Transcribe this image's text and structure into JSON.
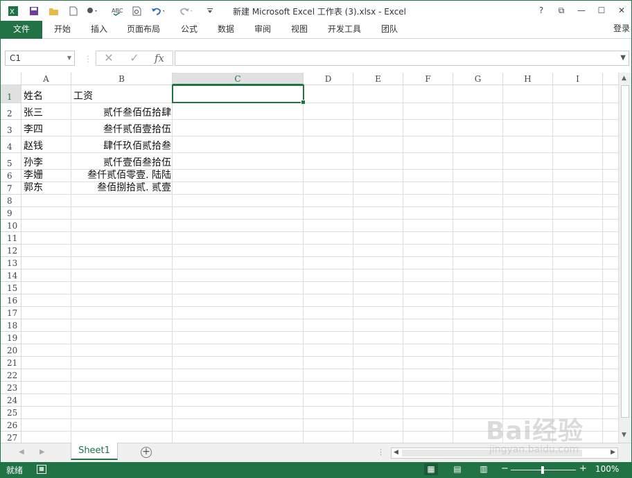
{
  "titlebar": {
    "title": "新建 Microsoft Excel 工作表 (3).xlsx - Excel",
    "help": "?",
    "ribbon_display": "⧉",
    "minimize": "—",
    "maximize": "☐",
    "close": "✕",
    "qa_icons": [
      "excel-logo-icon",
      "save-icon",
      "open-icon",
      "new-icon",
      "touch-mode-icon",
      "spelling-icon",
      "print-preview-icon",
      "undo-icon",
      "redo-icon",
      "customize-icon"
    ]
  },
  "ribbon": {
    "file": "文件",
    "tabs": [
      "开始",
      "插入",
      "页面布局",
      "公式",
      "数据",
      "审阅",
      "视图",
      "开发工具",
      "团队"
    ],
    "login": "登录"
  },
  "formula_bar": {
    "namebox": "C1",
    "cancel": "✕",
    "enter": "✓",
    "fx": "fx",
    "content": ""
  },
  "columns": [
    "A",
    "B",
    "C",
    "D",
    "E",
    "F",
    "G",
    "H",
    "I"
  ],
  "selected_column": "C",
  "rows": [
    "1",
    "2",
    "3",
    "4",
    "5",
    "6",
    "7",
    "8",
    "9",
    "10",
    "11",
    "12",
    "13",
    "14",
    "15",
    "16",
    "17",
    "18",
    "19",
    "20",
    "21",
    "22",
    "23",
    "24",
    "25",
    "26",
    "27"
  ],
  "cells": {
    "A1": "姓名",
    "B1": "工资",
    "A2": "张三",
    "B2": "贰仟叁佰伍拾肆",
    "A3": "李四",
    "B3": "叁仟贰佰壹拾伍",
    "A4": "赵钱",
    "B4": "肆仟玖佰贰拾叁",
    "A5": "孙李",
    "B5": "贰仟壹佰叁拾伍",
    "A6": "李姗",
    "B6": "叁仟贰佰零壹. 陆陆",
    "A7": "郭东",
    "B7": "叁佰捌拾贰. 贰壹"
  },
  "sheets": {
    "active": "Sheet1",
    "add": "+",
    "dots": "⋮"
  },
  "status": {
    "ready": "就绪",
    "zoom_minus": "−",
    "zoom_plus": "+",
    "zoom": "100%",
    "zoom_level": 1.0
  },
  "watermark": {
    "text": "Bai经验",
    "url": "jingyan.baidu.com"
  },
  "colors": {
    "accent": "#217346",
    "status_bar": "#217346"
  }
}
